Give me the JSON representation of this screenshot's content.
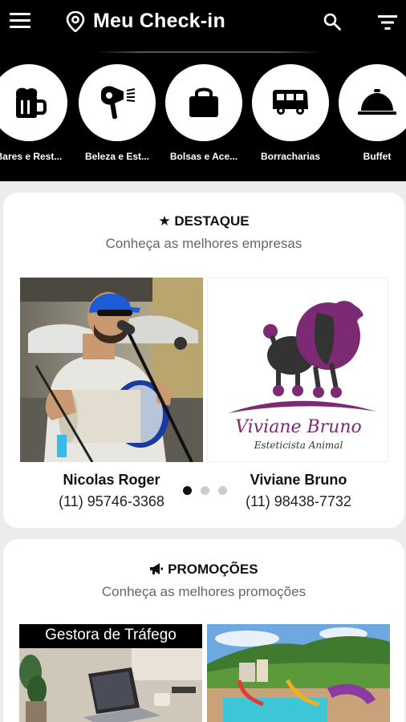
{
  "header": {
    "title": "Meu Check-in"
  },
  "categories": [
    {
      "label": "Bares e Rest...",
      "icon": "beer-mug-icon"
    },
    {
      "label": "Beleza e Est...",
      "icon": "hair-dryer-icon"
    },
    {
      "label": "Bolsas e Ace...",
      "icon": "handbag-icon"
    },
    {
      "label": "Borracharias",
      "icon": "van-icon"
    },
    {
      "label": "Buffet",
      "icon": "cloche-icon"
    }
  ],
  "destaque": {
    "title": "DESTAQUE",
    "subtitle": "Conheça as melhores empresas",
    "items": [
      {
        "name": "Nicolas Roger",
        "phone": "(11) 95746-3368"
      },
      {
        "name": "Viviane Bruno",
        "phone": "(11) 98438-7732",
        "logo_text": "Viviane Bruno",
        "logo_subtext": "Esteticista Animal"
      }
    ],
    "pager": {
      "count": 3,
      "active": 0
    }
  },
  "promocoes": {
    "title": "PROMOÇÕES",
    "subtitle": "Conheça as melhores promoções",
    "items": [
      {
        "caption": "Gestora de Tráfego"
      },
      {
        "caption": ""
      }
    ]
  },
  "colors": {
    "topbar_bg": "#000000",
    "poodle_purple": "#7b2a73",
    "card_bg": "#ffffff"
  }
}
